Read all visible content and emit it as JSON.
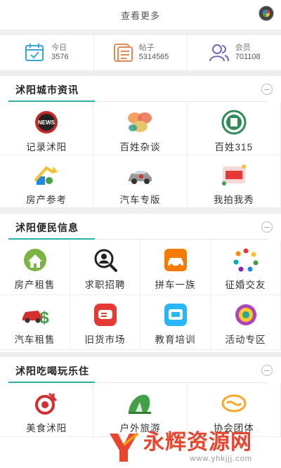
{
  "view_more": {
    "label": "查看更多",
    "icon": "chrome-icon"
  },
  "stats": [
    {
      "label": "今日",
      "value": "3576",
      "icon": "calendar-icon",
      "color": "#3aa6d8"
    },
    {
      "label": "帖子",
      "value": "5314565",
      "icon": "document-icon",
      "color": "#e08a5a"
    },
    {
      "label": "会员",
      "value": "701108",
      "icon": "members-icon",
      "color": "#6d6ab4"
    }
  ],
  "sections": [
    {
      "title": "沭阳城市资讯",
      "items": [
        {
          "label": "记录沭阳",
          "icon": "news-icon"
        },
        {
          "label": "百姓杂谈",
          "icon": "chat-bubbles-icon"
        },
        {
          "label": "百姓315",
          "icon": "consumer-315-icon"
        },
        {
          "label": "房产参考",
          "icon": "house-arrow-icon"
        },
        {
          "label": "汽车专版",
          "icon": "car-icon"
        },
        {
          "label": "我拍我秀",
          "icon": "photo-show-icon"
        }
      ]
    },
    {
      "title": "沭阳便民信息",
      "items": [
        {
          "label": "房产租售",
          "icon": "house-icon"
        },
        {
          "label": "求职招聘",
          "icon": "job-search-icon"
        },
        {
          "label": "拼车一族",
          "icon": "carpool-icon"
        },
        {
          "label": "征婚交友",
          "icon": "people-circle-icon"
        },
        {
          "label": "汽车租售",
          "icon": "car-dollar-icon"
        },
        {
          "label": "旧货市场",
          "icon": "second-hand-icon"
        },
        {
          "label": "教育培训",
          "icon": "education-icon"
        },
        {
          "label": "活动专区",
          "icon": "activity-icon"
        }
      ]
    },
    {
      "title": "沭阳吃喝玩乐住",
      "items": [
        {
          "label": "美食沭阳",
          "icon": "food-icon"
        },
        {
          "label": "户外旅游",
          "icon": "travel-icon"
        },
        {
          "label": "协会团体",
          "icon": "association-icon"
        }
      ]
    }
  ],
  "watermark": {
    "text": "永辉资源网",
    "url": "www.yhkjjj.com"
  }
}
